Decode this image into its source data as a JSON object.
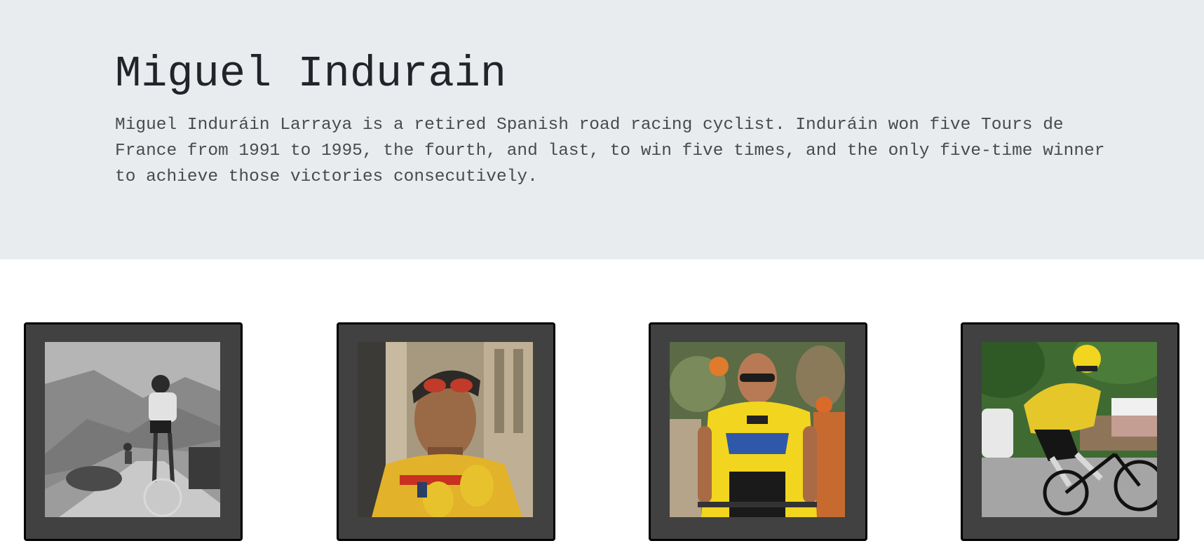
{
  "hero": {
    "title": "Miguel Indurain",
    "description": "Miguel Induráin Larraya is a retired Spanish road racing cyclist. Induráin won five Tours de France from 1991 to 1995, the fourth, and last, to win five times, and the only five-time winner to achieve those victories consecutively."
  },
  "gallery": {
    "photos": [
      {
        "subject": "black-and-white cyclist climbing mountain road"
      },
      {
        "subject": "cyclist in yellow jersey with bandana and goggles"
      },
      {
        "subject": "cyclist in yellow jersey wearing sunglasses"
      },
      {
        "subject": "cyclist in yellow jersey and yellow helmet descending"
      }
    ]
  },
  "colors": {
    "hero_background": "#e9ecef",
    "card_background": "#414141",
    "card_border": "#000000",
    "jersey_yellow": "#f2d51f"
  }
}
